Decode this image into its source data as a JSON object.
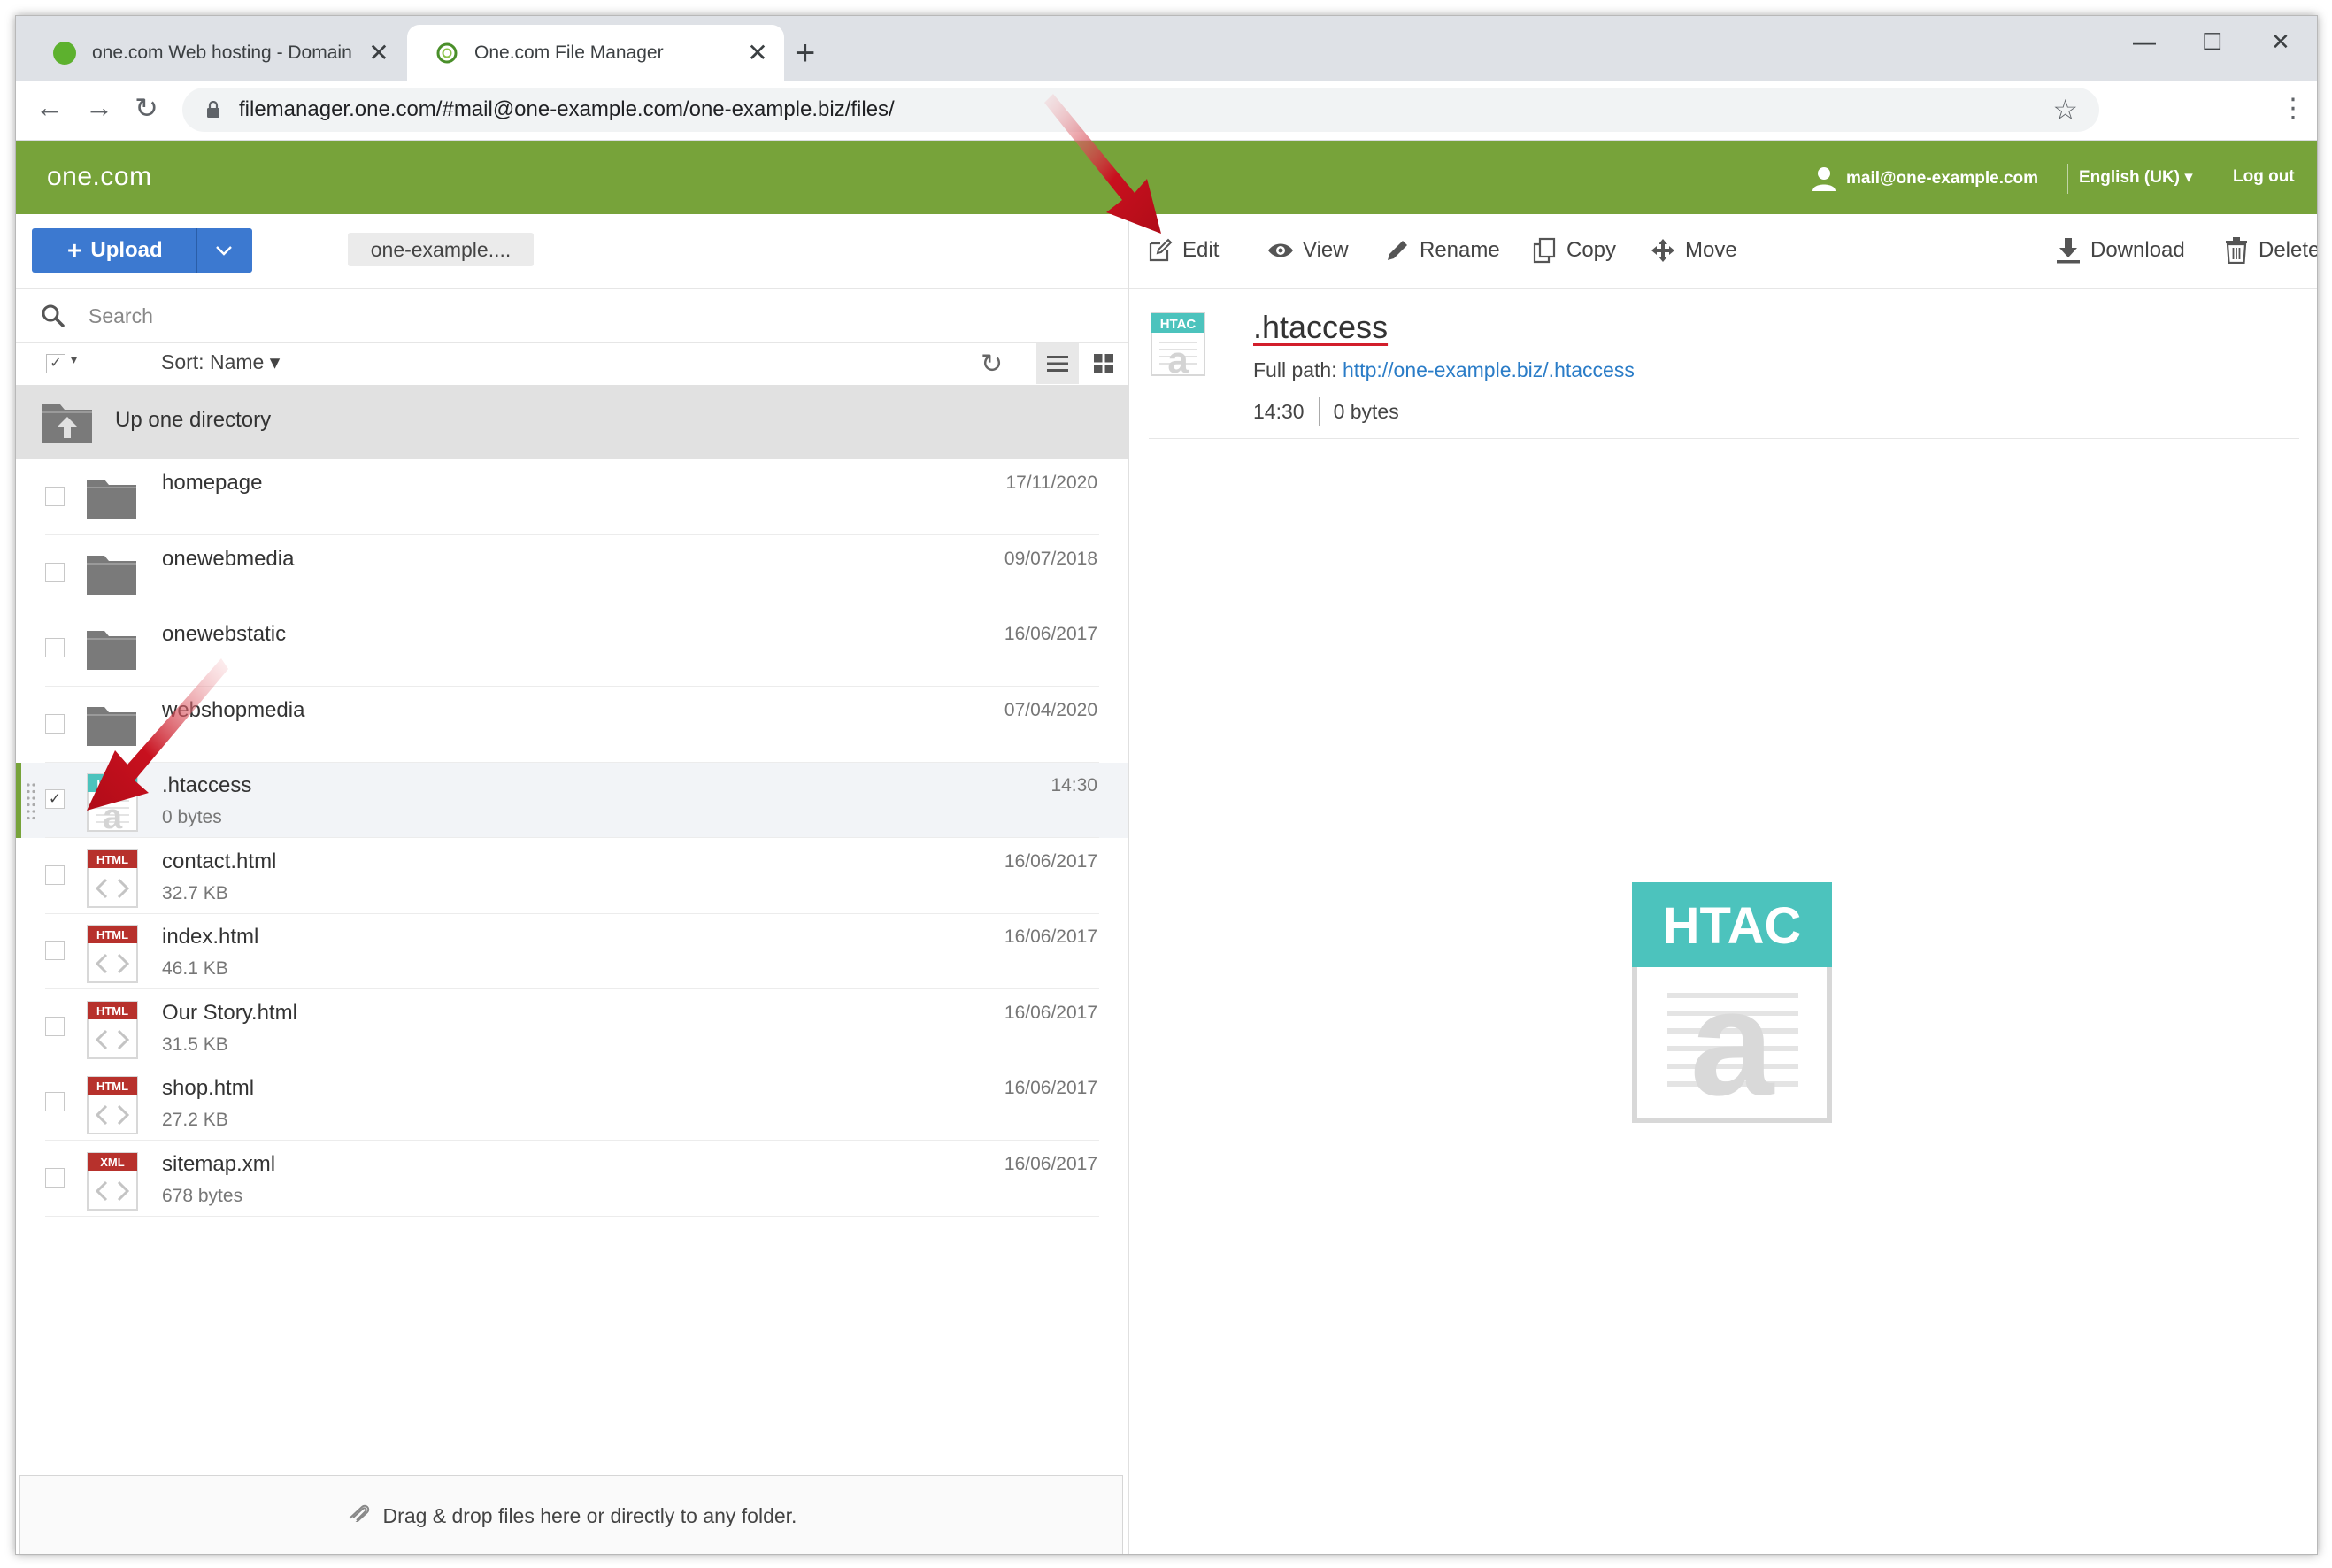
{
  "browser": {
    "tabs": [
      {
        "title": "one.com Web hosting  -  Domain",
        "favicon_color": "#5db12e"
      },
      {
        "title": "One.com File Manager",
        "favicon_color": "#4a8f2a"
      }
    ],
    "new_tab": "+",
    "window_controls": {
      "minimize": "—",
      "maximize": "☐",
      "close": "✕"
    },
    "tab_close": "✕",
    "url": "filemanager.one.com/#mail@one-example.com/one-example.biz/files/",
    "star": "☆",
    "menu": "⋮",
    "nav": {
      "back": "←",
      "forward": "→",
      "reload": "↻"
    }
  },
  "header": {
    "logo": "one.com",
    "user_email": "mail@one-example.com",
    "language": "English (UK) ▾",
    "logout": "Log out"
  },
  "sidebar": {
    "upload_label": "Upload",
    "upload_plus": "+",
    "breadcrumb": "one-example....",
    "search_placeholder": "Search",
    "sort_label": "Sort: Name ▾",
    "refresh": "↻",
    "select_all_check": "✓",
    "select_caret": "▾",
    "up_one": "Up one directory",
    "drop_hint": "Drag & drop files here or directly to any folder.",
    "drop_icon": "⚲"
  },
  "files": [
    {
      "name": "homepage",
      "size": "",
      "date": "17/11/2020",
      "type": "folder",
      "checked": ""
    },
    {
      "name": "onewebmedia",
      "size": "",
      "date": "09/07/2018",
      "type": "folder",
      "checked": ""
    },
    {
      "name": "onewebstatic",
      "size": "",
      "date": "16/06/2017",
      "type": "folder",
      "checked": ""
    },
    {
      "name": "webshopmedia",
      "size": "",
      "date": "07/04/2020",
      "type": "folder",
      "checked": ""
    },
    {
      "name": ".htaccess",
      "size": "0 bytes",
      "date": "14:30",
      "type": "htac",
      "badge": "HTAC",
      "checked": "✓"
    },
    {
      "name": "contact.html",
      "size": "32.7 KB",
      "date": "16/06/2017",
      "type": "code",
      "badge": "HTML",
      "checked": ""
    },
    {
      "name": "index.html",
      "size": "46.1 KB",
      "date": "16/06/2017",
      "type": "code",
      "badge": "HTML",
      "checked": ""
    },
    {
      "name": "Our Story.html",
      "size": "31.5 KB",
      "date": "16/06/2017",
      "type": "code",
      "badge": "HTML",
      "checked": ""
    },
    {
      "name": "shop.html",
      "size": "27.2 KB",
      "date": "16/06/2017",
      "type": "code",
      "badge": "HTML",
      "checked": ""
    },
    {
      "name": "sitemap.xml",
      "size": "678 bytes",
      "date": "16/06/2017",
      "type": "code",
      "badge": "XML",
      "checked": ""
    }
  ],
  "actions": {
    "edit": "Edit",
    "view": "View",
    "rename": "Rename",
    "copy": "Copy",
    "move": "Move",
    "download": "Download",
    "delete": "Delete"
  },
  "detail": {
    "name": ".htaccess",
    "path_label": "Full path:",
    "path_url": "http://one-example.biz/.htaccess",
    "time": "14:30",
    "size": "0 bytes",
    "badge": "HTAC",
    "big_badge": "HTAC",
    "glyph": "a"
  },
  "colors": {
    "header_green": "#77a33a",
    "upload_blue": "#3c79d0",
    "html_badge": "#b7312c",
    "htac_badge": "#4cc3bd",
    "arrow_red": "#c8101e",
    "link_blue": "#2a7cc7"
  }
}
